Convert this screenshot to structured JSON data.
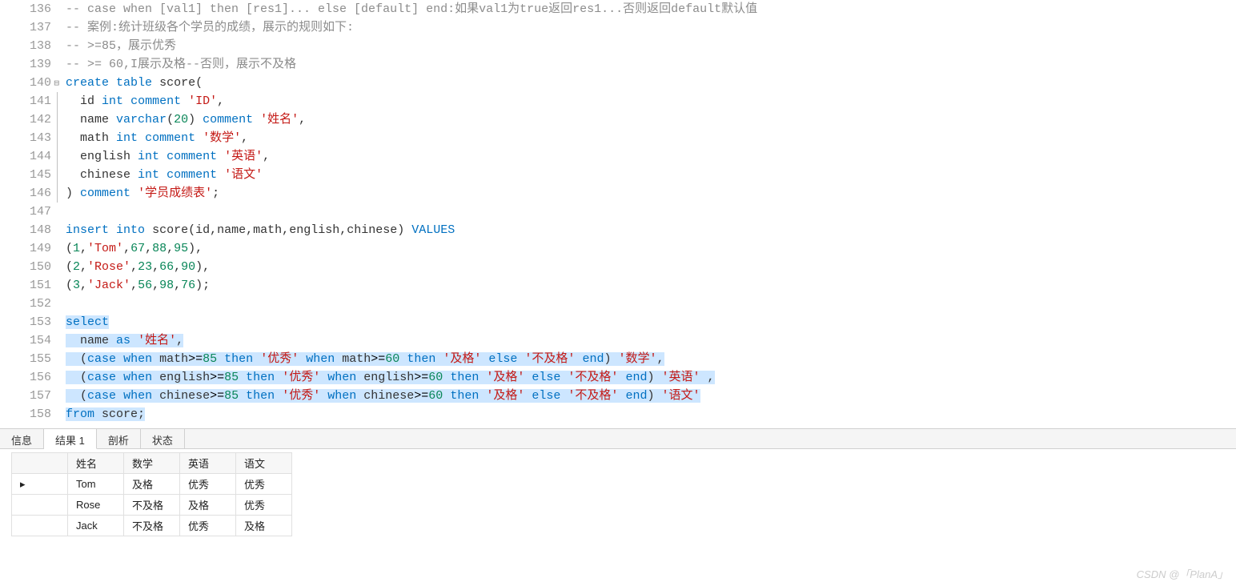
{
  "lines": [
    {
      "n": "136",
      "fold": "",
      "html": "<span class='com'>-- case when [val1] then [res1]... else [default] end:如果val1为true返回res1...否则返回default默认值</span>"
    },
    {
      "n": "137",
      "fold": "",
      "html": "<span class='com'>-- 案例:统计班级各个学员的成绩，展示的规则如下:</span>"
    },
    {
      "n": "138",
      "fold": "",
      "html": "<span class='com'>-- >=85，展示优秀</span>"
    },
    {
      "n": "139",
      "fold": "",
      "html": "<span class='com'>-- >= 60,I展示及格--否则，展示不及格</span>"
    },
    {
      "n": "140",
      "fold": "⊟",
      "html": "<span class='kw'>create</span> <span class='kw'>table</span> <span class='ident'>score</span><span class='paren'>(</span>"
    },
    {
      "n": "141",
      "fold": "|",
      "html": "  <span class='ident'>id</span> <span class='ty'>int</span> <span class='kw'>comment</span> <span class='str'>'ID'</span><span class='paren'>,</span>"
    },
    {
      "n": "142",
      "fold": "|",
      "html": "  <span class='ident'>name</span> <span class='ty'>varchar</span><span class='paren'>(</span><span class='num'>20</span><span class='paren'>)</span> <span class='kw'>comment</span> <span class='str'>'姓名'</span><span class='paren'>,</span>"
    },
    {
      "n": "143",
      "fold": "|",
      "html": "  <span class='ident'>math</span> <span class='ty'>int</span> <span class='kw'>comment</span> <span class='str'>'数学'</span><span class='paren'>,</span>"
    },
    {
      "n": "144",
      "fold": "|",
      "html": "  <span class='ident'>english</span> <span class='ty'>int</span> <span class='kw'>comment</span> <span class='str'>'英语'</span><span class='paren'>,</span>"
    },
    {
      "n": "145",
      "fold": "|",
      "html": "  <span class='ident'>chinese</span> <span class='ty'>int</span> <span class='kw'>comment</span> <span class='str'>'语文'</span>"
    },
    {
      "n": "146",
      "fold": "└",
      "html": "<span class='paren'>)</span> <span class='kw'>comment</span> <span class='str'>'学员成绩表'</span><span class='paren'>;</span>"
    },
    {
      "n": "147",
      "fold": "",
      "html": ""
    },
    {
      "n": "148",
      "fold": "",
      "html": "<span class='kw'>insert</span> <span class='kw'>into</span> <span class='ident'>score</span><span class='paren'>(</span><span class='ident'>id</span><span class='paren'>,</span><span class='ident'>name</span><span class='paren'>,</span><span class='ident'>math</span><span class='paren'>,</span><span class='ident'>english</span><span class='paren'>,</span><span class='ident'>chinese</span><span class='paren'>)</span> <span class='kw'>VALUES</span>"
    },
    {
      "n": "149",
      "fold": "",
      "html": "<span class='paren'>(</span><span class='num'>1</span><span class='paren'>,</span><span class='str'>'Tom'</span><span class='paren'>,</span><span class='num'>67</span><span class='paren'>,</span><span class='num'>88</span><span class='paren'>,</span><span class='num'>95</span><span class='paren'>),</span>"
    },
    {
      "n": "150",
      "fold": "",
      "html": "<span class='paren'>(</span><span class='num'>2</span><span class='paren'>,</span><span class='str'>'Rose'</span><span class='paren'>,</span><span class='num'>23</span><span class='paren'>,</span><span class='num'>66</span><span class='paren'>,</span><span class='num'>90</span><span class='paren'>),</span>"
    },
    {
      "n": "151",
      "fold": "",
      "html": "<span class='paren'>(</span><span class='num'>3</span><span class='paren'>,</span><span class='str'>'Jack'</span><span class='paren'>,</span><span class='num'>56</span><span class='paren'>,</span><span class='num'>98</span><span class='paren'>,</span><span class='num'>76</span><span class='paren'>);</span>"
    },
    {
      "n": "152",
      "fold": "",
      "html": ""
    },
    {
      "n": "153",
      "fold": "",
      "html": "<span class='hl'><span class='kw'>select</span></span>"
    },
    {
      "n": "154",
      "fold": "",
      "html": "<span class='hl'>  <span class='ident'>name</span> <span class='kw'>as</span> <span class='str'>'姓名'</span><span class='paren'>,</span></span>"
    },
    {
      "n": "155",
      "fold": "",
      "html": "<span class='hl'>  <span class='paren'>(</span><span class='kw'>case</span> <span class='kw'>when</span> <span class='ident'>math</span>&gt;=<span class='num'>85</span> <span class='kw'>then</span> <span class='str'>'优秀'</span> <span class='kw'>when</span> <span class='ident'>math</span>&gt;=<span class='num'>60</span> <span class='kw'>then</span> <span class='str'>'及格'</span> <span class='kw'>else</span> <span class='str'>'不及格'</span> <span class='kw'>end</span><span class='paren'>)</span> <span class='str'>'数学'</span><span class='paren'>,</span></span>"
    },
    {
      "n": "156",
      "fold": "",
      "html": "<span class='hl'>  <span class='paren'>(</span><span class='kw'>case</span> <span class='kw'>when</span> <span class='ident'>english</span>&gt;=<span class='num'>85</span> <span class='kw'>then</span> <span class='str'>'优秀'</span> <span class='kw'>when</span> <span class='ident'>english</span>&gt;=<span class='num'>60</span> <span class='kw'>then</span> <span class='str'>'及格'</span> <span class='kw'>else</span> <span class='str'>'不及格'</span> <span class='kw'>end</span><span class='paren'>)</span> <span class='str'>'英语'</span> <span class='paren'>,</span></span>"
    },
    {
      "n": "157",
      "fold": "",
      "html": "<span class='hl'>  <span class='paren'>(</span><span class='kw'>case</span> <span class='kw'>when</span> <span class='ident'>chinese</span>&gt;=<span class='num'>85</span> <span class='kw'>then</span> <span class='str'>'优秀'</span> <span class='kw'>when</span> <span class='ident'>chinese</span>&gt;=<span class='num'>60</span> <span class='kw'>then</span> <span class='str'>'及格'</span> <span class='kw'>else</span> <span class='str'>'不及格'</span> <span class='kw'>end</span><span class='paren'>)</span> <span class='str'>'语文'</span></span>"
    },
    {
      "n": "158",
      "fold": "",
      "html": "<span class='hl'><span class='kw'>from</span> <span class='ident'>score</span><span class='paren'>;</span></span>"
    }
  ],
  "tabs": [
    "信息",
    "结果 1",
    "剖析",
    "状态"
  ],
  "activeTab": 1,
  "result": {
    "columns": [
      "姓名",
      "数学",
      "英语",
      "语文"
    ],
    "rows": [
      {
        "indicator": "▸",
        "cells": [
          "Tom",
          "及格",
          "优秀",
          "优秀"
        ]
      },
      {
        "indicator": "",
        "cells": [
          "Rose",
          "不及格",
          "及格",
          "优秀"
        ]
      },
      {
        "indicator": "",
        "cells": [
          "Jack",
          "不及格",
          "优秀",
          "及格"
        ]
      }
    ]
  },
  "watermark": "CSDN @「PlanA」"
}
